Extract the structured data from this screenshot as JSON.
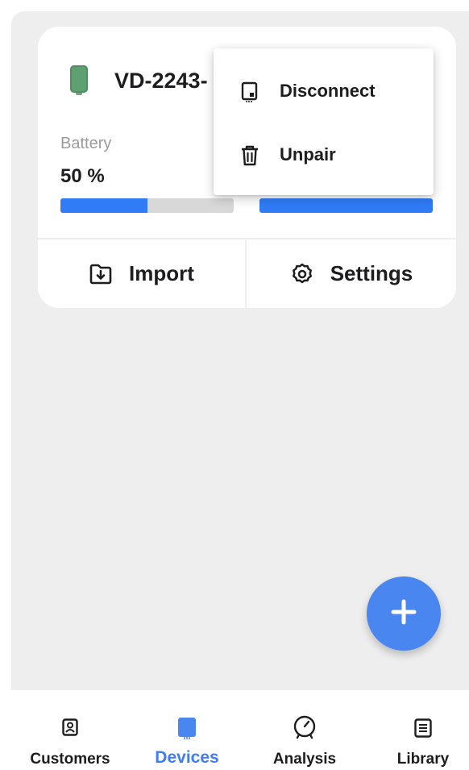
{
  "device": {
    "name": "VD-2243-",
    "battery_label": "Battery",
    "battery_value": "50 %",
    "battery_level": 0.5,
    "second_level": 1.0
  },
  "card_actions": {
    "import_label": "Import",
    "settings_label": "Settings"
  },
  "menu": {
    "disconnect_label": "Disconnect",
    "unpair_label": "Unpair"
  },
  "nav": {
    "items": [
      {
        "label": "Customers",
        "icon": "contact-icon"
      },
      {
        "label": "Devices",
        "icon": "device-icon",
        "active": true
      },
      {
        "label": "Analysis",
        "icon": "gauge-icon"
      },
      {
        "label": "Library",
        "icon": "document-icon"
      }
    ]
  },
  "colors": {
    "accent": "#2f7cf6",
    "fab": "#4a86f0",
    "device_green": "#5fa071",
    "background": "#eeeeee"
  }
}
